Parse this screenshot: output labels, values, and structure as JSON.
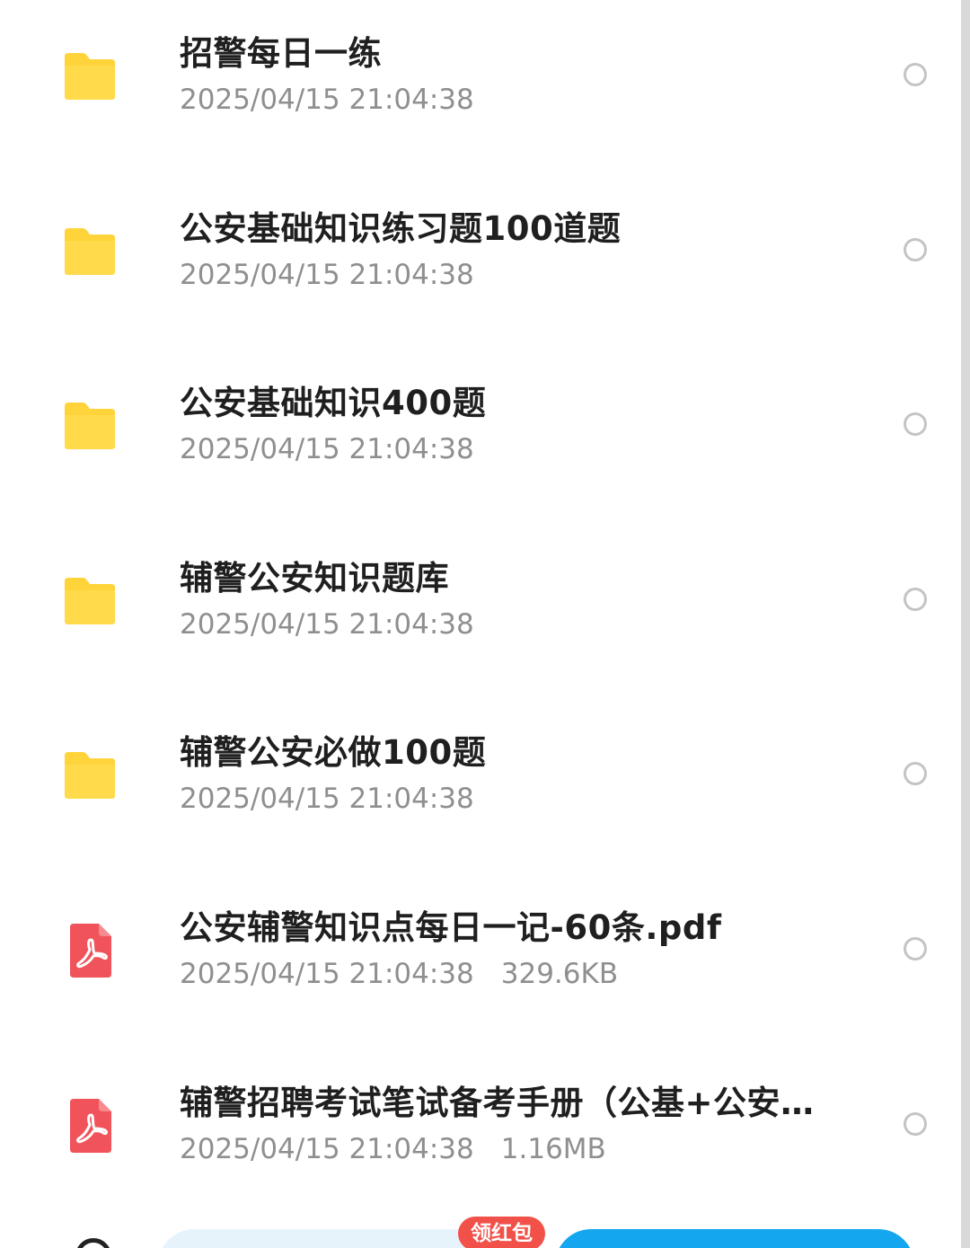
{
  "files": [
    {
      "name": "招警每日一练",
      "date": "2025/04/15 21:04:38",
      "size": "",
      "type": "folder"
    },
    {
      "name": "公安基础知识练习题100道题",
      "date": "2025/04/15 21:04:38",
      "size": "",
      "type": "folder"
    },
    {
      "name": "公安基础知识400题",
      "date": "2025/04/15 21:04:38",
      "size": "",
      "type": "folder"
    },
    {
      "name": "辅警公安知识题库",
      "date": "2025/04/15 21:04:38",
      "size": "",
      "type": "folder"
    },
    {
      "name": "辅警公安必做100题",
      "date": "2025/04/15 21:04:38",
      "size": "",
      "type": "folder"
    },
    {
      "name": "公安辅警知识点每日一记-60条.pdf",
      "date": "2025/04/15 21:04:38",
      "size": "329.6KB",
      "type": "pdf"
    },
    {
      "name": "辅警招聘考试笔试备考手册（公基+公安…",
      "date": "2025/04/15 21:04:38",
      "size": "1.16MB",
      "type": "pdf"
    }
  ],
  "bottom_bar": {
    "badge_label": "领红包"
  },
  "icons": {
    "folder": "folder-icon",
    "pdf": "pdf-file-icon",
    "select": "radio-circle-icon"
  },
  "colors": {
    "folder": "#FFD43B",
    "pdf": "#F0535A",
    "primary_button": "#14A6EF",
    "badge": "#F2514A"
  }
}
